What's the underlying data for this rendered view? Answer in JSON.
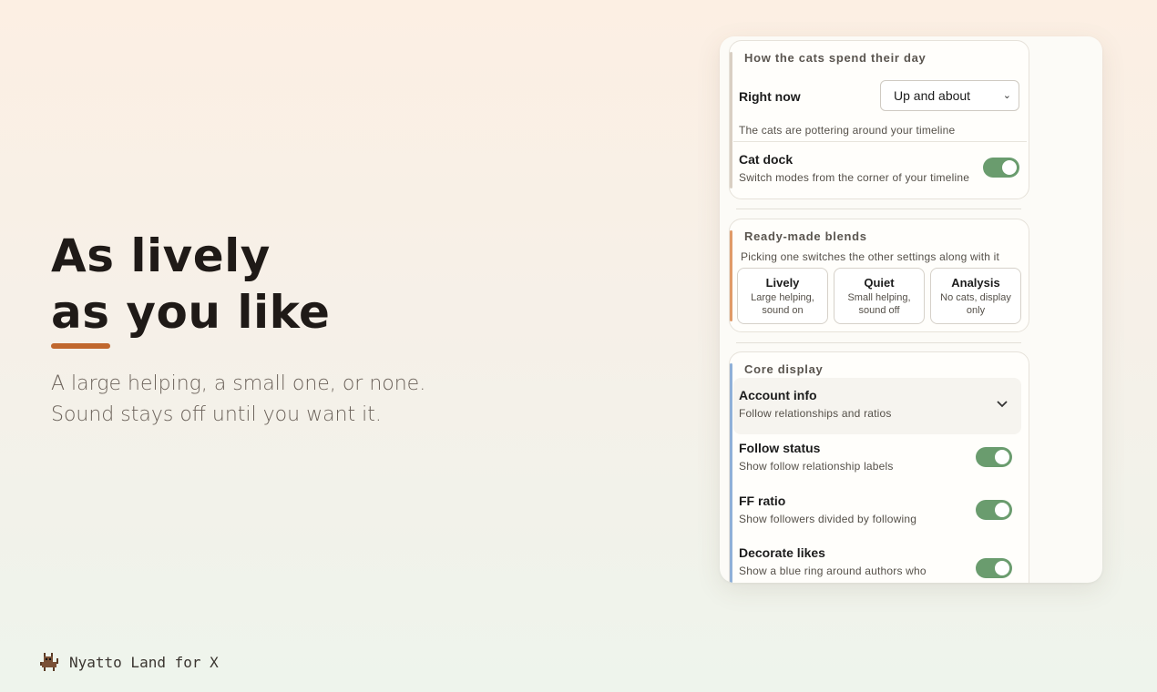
{
  "hero": {
    "line1": "As lively",
    "line2": "as you like",
    "accent_color": "#c0672e"
  },
  "subtitle": {
    "line1": "A large helping, a small one, or none.",
    "line2": "Sound stays off until you want it."
  },
  "brand": {
    "icon": "cat-icon",
    "name": "Nyatto Land for X"
  },
  "panel": {
    "day": {
      "title": "How the cats spend their day",
      "right_now_label": "Right now",
      "right_now_value": "Up and about",
      "right_now_desc": "The cats are pottering around your timeline",
      "dock_title": "Cat dock",
      "dock_desc": "Switch modes from the corner of your timeline",
      "dock_on": true,
      "bar_color": "#d9cfc3"
    },
    "blends": {
      "title": "Ready-made blends",
      "desc": "Picking one switches the other settings along with it",
      "bar_color": "#e09a68",
      "options": [
        {
          "name": "Lively",
          "desc_line1": "Large helping,",
          "desc_line2": "sound on"
        },
        {
          "name": "Quiet",
          "desc_line1": "Small helping,",
          "desc_line2": "sound off"
        },
        {
          "name": "Analysis",
          "desc_line1": "No cats, display",
          "desc_line2": "only"
        }
      ]
    },
    "core": {
      "title": "Core display",
      "bar_color": "#8fb0d8",
      "account_title": "Account info",
      "account_desc": "Follow relationships and ratios",
      "rows": [
        {
          "title": "Follow status",
          "desc": "Show follow relationship labels",
          "on": true
        },
        {
          "title": "FF ratio",
          "desc": "Show followers divided by following",
          "on": true
        },
        {
          "title": "Decorate likes",
          "desc": "Show a blue ring around authors who",
          "on": true
        }
      ]
    },
    "toggle_color": "#6a9c6e"
  }
}
